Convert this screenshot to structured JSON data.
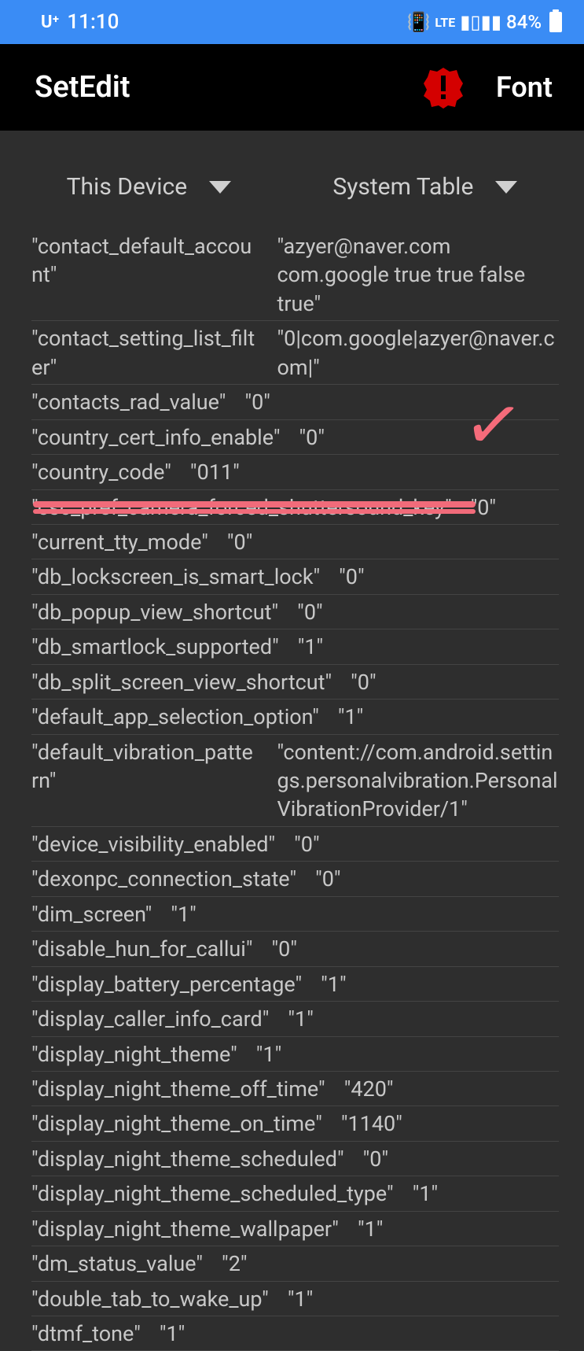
{
  "status": {
    "carrier": "U⁺",
    "time": "11:10",
    "network": "LTE",
    "battery_pct": "84%"
  },
  "app": {
    "title": "SetEdit",
    "font_label": "Font"
  },
  "dropdowns": {
    "left": "This Device",
    "right": "System Table"
  },
  "rows": [
    {
      "k": "\"contact_default_account\"",
      "v": "\"azyer@naver.com com.google  true true false true\"",
      "layout": "two"
    },
    {
      "k": "\"contact_setting_list_filter\"",
      "v": "\"0|com.google|azyer@naver.com|\"",
      "layout": "two"
    },
    {
      "k": "\"contacts_rad_value\"",
      "v": "\"0\"",
      "layout": "inline"
    },
    {
      "k": "\"country_cert_info_enable\"",
      "v": "\"0\"",
      "layout": "inline"
    },
    {
      "k": "\"country_code\"",
      "v": "\"011\"",
      "layout": "inline"
    },
    {
      "k": "\"csc_pref_camera_forced_shuttersound_key\"",
      "v": "\"0\"",
      "layout": "inline"
    },
    {
      "k": "\"current_tty_mode\"",
      "v": "\"0\"",
      "layout": "inline"
    },
    {
      "k": "\"db_lockscreen_is_smart_lock\"",
      "v": "\"0\"",
      "layout": "inline"
    },
    {
      "k": "\"db_popup_view_shortcut\"",
      "v": "\"0\"",
      "layout": "inline"
    },
    {
      "k": "\"db_smartlock_supported\"",
      "v": "\"1\"",
      "layout": "inline"
    },
    {
      "k": "\"db_split_screen_view_shortcut\"",
      "v": "\"0\"",
      "layout": "inline"
    },
    {
      "k": "\"default_app_selection_option\"",
      "v": "\"1\"",
      "layout": "inline"
    },
    {
      "k": "\"default_vibration_pattern\"",
      "v": "\"content://com.android.settings.personalvibration.PersonalVibrationProvider/1\"",
      "layout": "two"
    },
    {
      "k": "\"device_visibility_enabled\"",
      "v": "\"0\"",
      "layout": "inline"
    },
    {
      "k": "\"dexonpc_connection_state\"",
      "v": "\"0\"",
      "layout": "inline"
    },
    {
      "k": "\"dim_screen\"",
      "v": "\"1\"",
      "layout": "inline"
    },
    {
      "k": "\"disable_hun_for_callui\"",
      "v": "\"0\"",
      "layout": "inline"
    },
    {
      "k": "\"display_battery_percentage\"",
      "v": "\"1\"",
      "layout": "inline"
    },
    {
      "k": "\"display_caller_info_card\"",
      "v": "\"1\"",
      "layout": "inline"
    },
    {
      "k": "\"display_night_theme\"",
      "v": "\"1\"",
      "layout": "inline"
    },
    {
      "k": "\"display_night_theme_off_time\"",
      "v": "\"420\"",
      "layout": "inline"
    },
    {
      "k": "\"display_night_theme_on_time\"",
      "v": "\"1140\"",
      "layout": "inline"
    },
    {
      "k": "\"display_night_theme_scheduled\"",
      "v": "\"0\"",
      "layout": "inline"
    },
    {
      "k": "\"display_night_theme_scheduled_type\"",
      "v": "\"1\"",
      "layout": "inline"
    },
    {
      "k": "\"display_night_theme_wallpaper\"",
      "v": "\"1\"",
      "layout": "inline"
    },
    {
      "k": "\"dm_status_value\"",
      "v": "\"2\"",
      "layout": "inline"
    },
    {
      "k": "\"double_tab_to_wake_up\"",
      "v": "\"1\"",
      "layout": "inline"
    },
    {
      "k": "\"dtmf_tone\"",
      "v": "\"1\"",
      "layout": "inline"
    }
  ]
}
